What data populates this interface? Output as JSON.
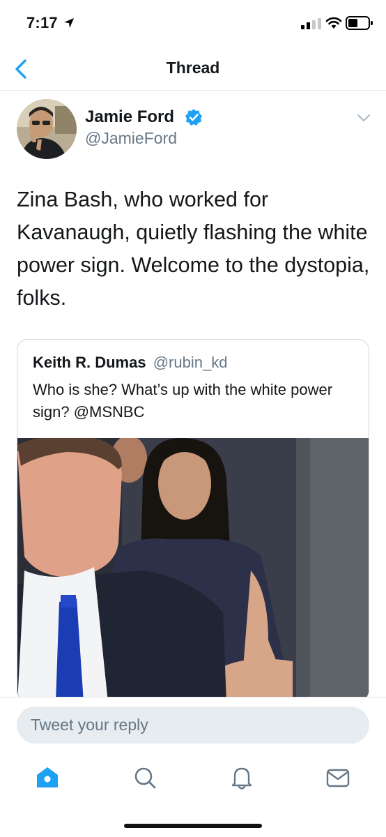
{
  "status_bar": {
    "time": "7:17",
    "icons": [
      "location-arrow-icon",
      "cellular-signal-icon",
      "wifi-icon",
      "battery-icon"
    ]
  },
  "nav": {
    "title": "Thread",
    "back_icon": "chevron-left-icon"
  },
  "tweet": {
    "author_name": "Jamie Ford",
    "author_handle": "@JamieFord",
    "verified": true,
    "text": "Zina Bash, who worked for Kavanaugh, quietly flashing the white power sign. Welcome to the dystopia, folks.",
    "quote": {
      "author_name": "Keith R. Dumas",
      "author_handle": "@rubin_kd",
      "text": "Who is she? What’s up with the white power sign? @MSNBC",
      "media": "video-still"
    }
  },
  "reply": {
    "placeholder": "Tweet your reply"
  },
  "tab_bar": {
    "items": [
      "home-icon",
      "search-icon",
      "notifications-bell-icon",
      "messages-envelope-icon"
    ],
    "active": "home-icon"
  },
  "colors": {
    "accent": "#1da1f2",
    "secondary_text": "#657786",
    "divider": "#e1e8ed",
    "reply_bg": "#e6ecf0"
  }
}
